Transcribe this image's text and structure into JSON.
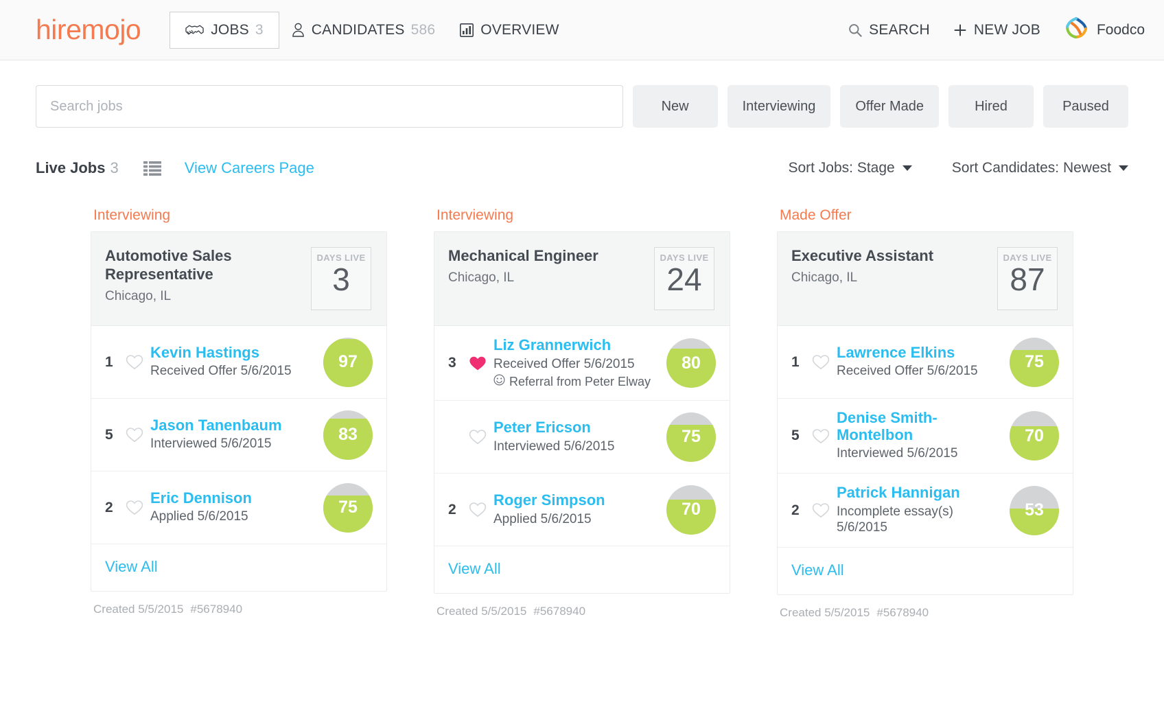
{
  "app": {
    "logo": "hiremojo",
    "accent_orange": "#f47b50",
    "accent_blue": "#2bbdf0",
    "score_green": "#bada55",
    "score_gray": "#d2d4d5",
    "heart_pink": "#ef2f71"
  },
  "nav": {
    "items": [
      {
        "label": "JOBS",
        "count": "3",
        "icon": "handshake-icon",
        "active": true
      },
      {
        "label": "CANDIDATES",
        "count": "586",
        "icon": "person-icon",
        "active": false
      },
      {
        "label": "OVERVIEW",
        "count": "",
        "icon": "bar-chart-icon",
        "active": false
      }
    ],
    "search_label": "SEARCH",
    "new_job_label": "NEW JOB",
    "company": "Foodco"
  },
  "search": {
    "placeholder": "Search jobs",
    "value": "",
    "filters": [
      "New",
      "Interviewing",
      "Offer Made",
      "Hired",
      "Paused"
    ]
  },
  "toolbar": {
    "live_jobs_label": "Live Jobs",
    "live_jobs_count": "3",
    "careers_link": "View Careers Page",
    "sort_jobs": "Sort Jobs: Stage",
    "sort_candidates": "Sort Candidates: Newest"
  },
  "cards": [
    {
      "stage": "Interviewing",
      "title": "Automotive Sales Representative",
      "location": "Chicago, IL",
      "days_live_label": "DAYS LIVE",
      "days_live": "3",
      "candidates": [
        {
          "rank": "1",
          "favorite": false,
          "name": "Kevin Hastings",
          "status": "Received Offer 5/6/2015",
          "note": "",
          "score": 97
        },
        {
          "rank": "5",
          "favorite": false,
          "name": "Jason Tanenbaum",
          "status": "Interviewed 5/6/2015",
          "note": "",
          "score": 83
        },
        {
          "rank": "2",
          "favorite": false,
          "name": "Eric Dennison",
          "status": "Applied 5/6/2015",
          "note": "",
          "score": 75
        }
      ],
      "view_all": "View All",
      "created": "Created 5/5/2015",
      "job_id": "#5678940"
    },
    {
      "stage": "Interviewing",
      "title": "Mechanical Engineer",
      "location": "Chicago, IL",
      "days_live_label": "DAYS LIVE",
      "days_live": "24",
      "candidates": [
        {
          "rank": "3",
          "favorite": true,
          "name": "Liz Grannerwich",
          "status": "Received Offer 5/6/2015",
          "note": "Referral from Peter Elway",
          "score": 80
        },
        {
          "rank": "",
          "favorite": false,
          "name": "Peter Ericson",
          "status": "Interviewed 5/6/2015",
          "note": "",
          "score": 75
        },
        {
          "rank": "2",
          "favorite": false,
          "name": "Roger Simpson",
          "status": "Applied 5/6/2015",
          "note": "",
          "score": 70
        }
      ],
      "view_all": "View All",
      "created": "Created 5/5/2015",
      "job_id": "#5678940"
    },
    {
      "stage": "Made Offer",
      "title": "Executive Assistant",
      "location": "Chicago, IL",
      "days_live_label": "DAYS LIVE",
      "days_live": "87",
      "candidates": [
        {
          "rank": "1",
          "favorite": false,
          "name": "Lawrence Elkins",
          "status": "Received Offer 5/6/2015",
          "note": "",
          "score": 75
        },
        {
          "rank": "5",
          "favorite": false,
          "name": "Denise Smith-Montelbon",
          "status": "Interviewed 5/6/2015",
          "note": "",
          "score": 70
        },
        {
          "rank": "2",
          "favorite": false,
          "name": "Patrick Hannigan",
          "status": "Incomplete essay(s) 5/6/2015",
          "note": "",
          "score": 53
        }
      ],
      "view_all": "View All",
      "created": "Created 5/5/2015",
      "job_id": "#5678940"
    }
  ]
}
